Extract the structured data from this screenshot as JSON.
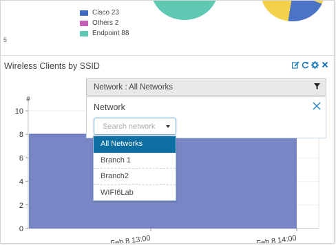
{
  "top_widget": {
    "legend": [
      {
        "label": "Cisco 23",
        "color": "#3f6bc4"
      },
      {
        "label": "Others 2",
        "color": "#c45fb5"
      },
      {
        "label": "Endpoint 88",
        "color": "#5ec8b3"
      }
    ],
    "stray_char": "5"
  },
  "widget": {
    "title": "Wireless Clients by SSID",
    "tool_icons": [
      "edit-icon",
      "refresh-icon",
      "gear-icon",
      "close-icon"
    ],
    "filter_bar_label": "Network : All Networks",
    "filter_icon": "funnel-icon"
  },
  "filter_panel": {
    "label": "Network",
    "placeholder": "Search network",
    "options": [
      "All Networks",
      "Branch 1",
      "Branch2",
      "WIFI6Lab"
    ],
    "selected_option": "All Networks"
  },
  "chart_data": {
    "type": "area",
    "ylabel": "#",
    "yticks": [
      "0",
      "2",
      "4",
      "6",
      "8",
      "10"
    ],
    "ylim": [
      0,
      10
    ],
    "xticks": [
      "Feb 8 13:00",
      "Feb 8 14:00"
    ],
    "series": [
      {
        "x": [
          "start",
          "Feb 8 14:00"
        ],
        "values": [
          8,
          8
        ],
        "color": "#7986c5"
      }
    ],
    "grid": true
  }
}
